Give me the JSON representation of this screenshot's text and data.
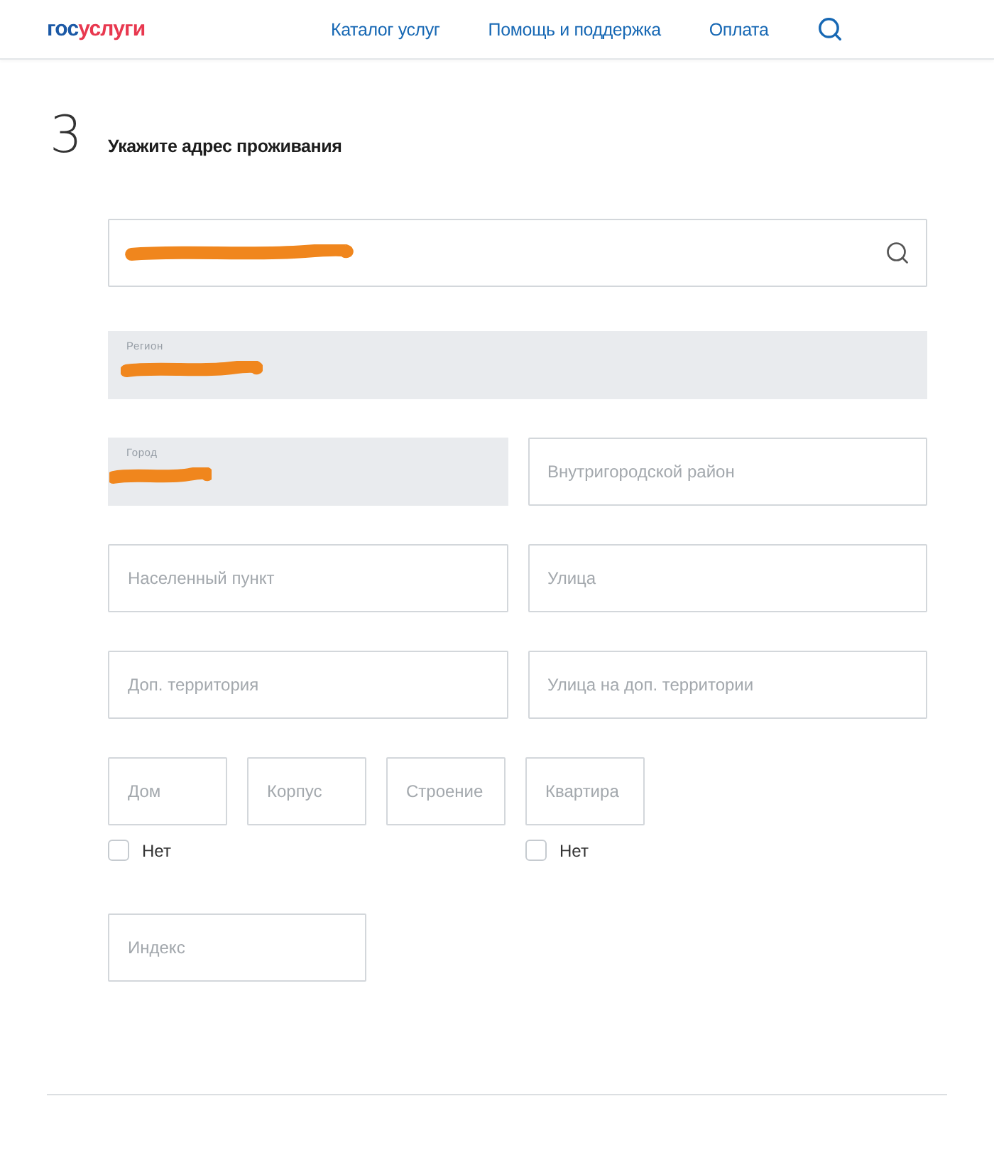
{
  "header": {
    "logo": {
      "parts": [
        "гос",
        "услуги"
      ]
    },
    "nav": [
      "Каталог услуг",
      "Помощь и поддержка",
      "Оплата"
    ]
  },
  "step": {
    "number": "3",
    "title": "Укажите адрес проживания"
  },
  "rows": [
    {
      "kind": "full",
      "fields": [
        {
          "kind": "search",
          "redacted": true
        }
      ]
    },
    {
      "kind": "full",
      "fields": [
        {
          "kind": "prefilled",
          "label": "Регион",
          "redacted": true
        }
      ]
    },
    {
      "kind": "pair",
      "fields": [
        {
          "kind": "prefilled",
          "label": "Город",
          "redacted": true
        },
        {
          "kind": "text",
          "placeholder": "Внутригородской район"
        }
      ]
    },
    {
      "kind": "pair",
      "fields": [
        {
          "kind": "text",
          "placeholder": "Населенный пункт"
        },
        {
          "kind": "text",
          "placeholder": "Улица"
        }
      ]
    },
    {
      "kind": "pair",
      "fields": [
        {
          "kind": "text",
          "placeholder": "Доп. территория"
        },
        {
          "kind": "text",
          "placeholder": "Улица на доп. территории"
        }
      ]
    },
    {
      "kind": "small",
      "fields": [
        {
          "kind": "text",
          "placeholder": "Дом",
          "checkbox": {
            "label": "Нет",
            "checked": false
          }
        },
        {
          "kind": "text",
          "placeholder": "Корпус"
        },
        {
          "kind": "text",
          "placeholder": "Строение"
        },
        {
          "kind": "text",
          "placeholder": "Квартира",
          "checkbox": {
            "label": "Нет",
            "checked": false
          }
        }
      ]
    },
    {
      "kind": "short",
      "fields": [
        {
          "kind": "text",
          "placeholder": "Индекс"
        }
      ]
    }
  ]
}
